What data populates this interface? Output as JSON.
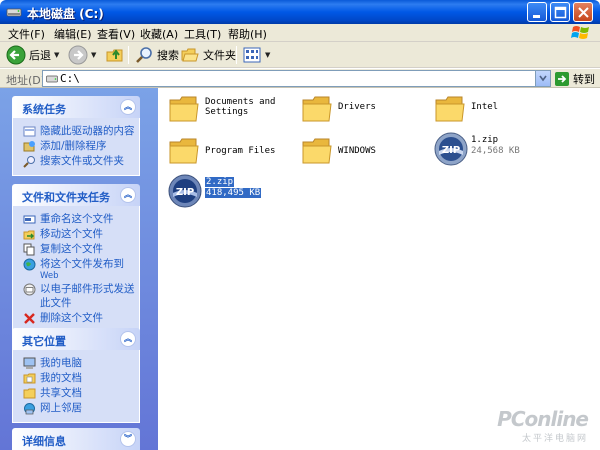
{
  "window": {
    "title": "本地磁盘 (C:)"
  },
  "menu": {
    "items": [
      "文件(F)",
      "编辑(E)",
      "查看(V)",
      "收藏(A)",
      "工具(T)",
      "帮助(H)"
    ]
  },
  "toolbar": {
    "back_label": "后退",
    "search_label": "搜索",
    "folders_label": "文件夹"
  },
  "address": {
    "label": "地址(D)",
    "value": "C:\\",
    "go_label": "转到"
  },
  "panels": {
    "system_tasks": {
      "title": "系统任务",
      "items": [
        {
          "label": "隐藏此驱动器的内容",
          "icon": "hide-contents-icon"
        },
        {
          "label": "添加/删除程序",
          "icon": "add-remove-programs-icon"
        },
        {
          "label": "搜索文件或文件夹",
          "icon": "search-icon"
        }
      ]
    },
    "file_tasks": {
      "title": "文件和文件夹任务",
      "items": [
        {
          "label": "重命名这个文件",
          "icon": "rename-icon"
        },
        {
          "label": "移动这个文件",
          "icon": "move-icon"
        },
        {
          "label": "复制这个文件",
          "icon": "copy-icon"
        },
        {
          "label": "将这个文件发布到",
          "sub": "Web",
          "icon": "publish-web-icon"
        },
        {
          "label": "以电子邮件形式发送",
          "sub2": "此文件",
          "icon": "email-icon"
        },
        {
          "label": "删除这个文件",
          "icon": "delete-icon"
        }
      ]
    },
    "other_places": {
      "title": "其它位置",
      "items": [
        {
          "label": "我的电脑",
          "icon": "my-computer-icon"
        },
        {
          "label": "我的文档",
          "icon": "my-documents-icon"
        },
        {
          "label": "共享文档",
          "icon": "shared-documents-icon"
        },
        {
          "label": "网上邻居",
          "icon": "network-places-icon"
        }
      ]
    },
    "details": {
      "title": "详细信息"
    }
  },
  "files": [
    {
      "name": "Documents and\nSettings",
      "type": "folder"
    },
    {
      "name": "Drivers",
      "type": "folder"
    },
    {
      "name": "Intel",
      "type": "folder"
    },
    {
      "name": "Program Files",
      "type": "folder"
    },
    {
      "name": "WINDOWS",
      "type": "folder"
    },
    {
      "name": "1.zip",
      "size": "24,568 KB",
      "type": "zip"
    },
    {
      "name": "2.zip",
      "size": "418,495 KB",
      "type": "zip",
      "selected": true
    }
  ],
  "watermark": {
    "main": "PConline",
    "sub": "太平洋电脑网"
  },
  "colors": {
    "titlebar": "#0058e6",
    "taskpane": "#6f8ee0",
    "link": "#215dc6",
    "selection": "#316ac5"
  }
}
